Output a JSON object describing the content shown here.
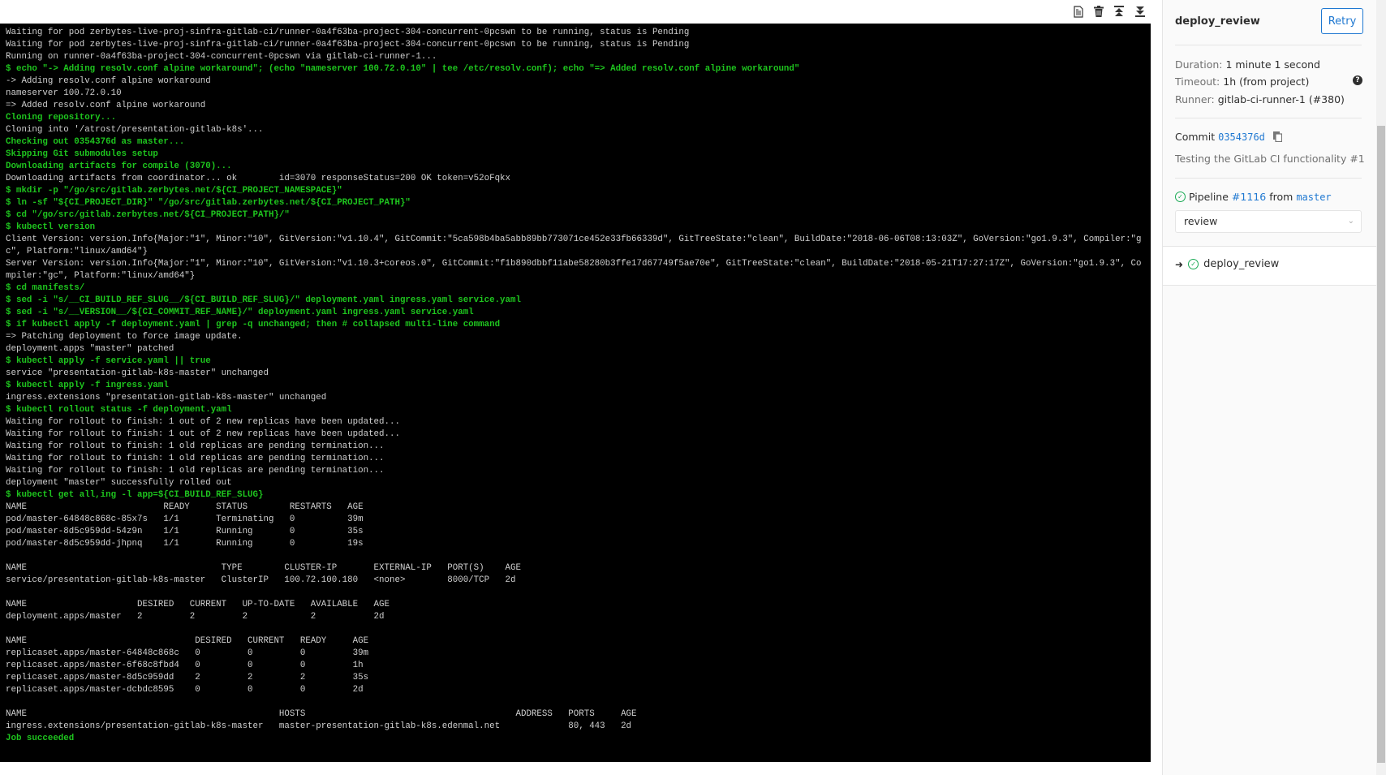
{
  "toolbar": {
    "icons": [
      "raw-log-icon",
      "erase-log-icon",
      "scroll-top-icon",
      "scroll-bottom-icon"
    ]
  },
  "log": [
    {
      "type": "out",
      "text": "Waiting for pod zerbytes-live-proj-sinfra-gitlab-ci/runner-0a4f63ba-project-304-concurrent-0pcswn to be running, status is Pending"
    },
    {
      "type": "out",
      "text": "Waiting for pod zerbytes-live-proj-sinfra-gitlab-ci/runner-0a4f63ba-project-304-concurrent-0pcswn to be running, status is Pending"
    },
    {
      "type": "out",
      "text": "Running on runner-0a4f63ba-project-304-concurrent-0pcswn via gitlab-ci-runner-1..."
    },
    {
      "type": "cmd",
      "text": "$ echo \"-> Adding resolv.conf alpine workaround\"; (echo \"nameserver 100.72.0.10\" | tee /etc/resolv.conf); echo \"=> Added resolv.conf alpine workaround\""
    },
    {
      "type": "out",
      "text": "-> Adding resolv.conf alpine workaround"
    },
    {
      "type": "out",
      "text": "nameserver 100.72.0.10"
    },
    {
      "type": "out",
      "text": "=> Added resolv.conf alpine workaround"
    },
    {
      "type": "section",
      "text": "Cloning repository..."
    },
    {
      "type": "out",
      "text": "Cloning into '/atrost/presentation-gitlab-k8s'..."
    },
    {
      "type": "section",
      "text": "Checking out 0354376d as master..."
    },
    {
      "type": "section",
      "text": "Skipping Git submodules setup"
    },
    {
      "type": "section",
      "text": "Downloading artifacts for compile (3070)..."
    },
    {
      "type": "out",
      "text": "Downloading artifacts from coordinator... ok        id=3070 responseStatus=200 OK token=v52oFqkx"
    },
    {
      "type": "cmd",
      "text": "$ mkdir -p \"/go/src/gitlab.zerbytes.net/${CI_PROJECT_NAMESPACE}\""
    },
    {
      "type": "cmd",
      "text": "$ ln -sf \"${CI_PROJECT_DIR}\" \"/go/src/gitlab.zerbytes.net/${CI_PROJECT_PATH}\""
    },
    {
      "type": "cmd",
      "text": "$ cd \"/go/src/gitlab.zerbytes.net/${CI_PROJECT_PATH}/\""
    },
    {
      "type": "cmd",
      "text": "$ kubectl version"
    },
    {
      "type": "out",
      "text": "Client Version: version.Info{Major:\"1\", Minor:\"10\", GitVersion:\"v1.10.4\", GitCommit:\"5ca598b4ba5abb89bb773071ce452e33fb66339d\", GitTreeState:\"clean\", BuildDate:\"2018-06-06T08:13:03Z\", GoVersion:\"go1.9.3\", Compiler:\"gc\", Platform:\"linux/amd64\"}"
    },
    {
      "type": "out",
      "text": "Server Version: version.Info{Major:\"1\", Minor:\"10\", GitVersion:\"v1.10.3+coreos.0\", GitCommit:\"f1b890dbbf11abe58280b3ffe17d67749f5ae70e\", GitTreeState:\"clean\", BuildDate:\"2018-05-21T17:27:17Z\", GoVersion:\"go1.9.3\", Compiler:\"gc\", Platform:\"linux/amd64\"}"
    },
    {
      "type": "cmd",
      "text": "$ cd manifests/"
    },
    {
      "type": "cmd",
      "text": "$ sed -i \"s/__CI_BUILD_REF_SLUG__/${CI_BUILD_REF_SLUG}/\" deployment.yaml ingress.yaml service.yaml"
    },
    {
      "type": "cmd",
      "text": "$ sed -i \"s/__VERSION__/${CI_COMMIT_REF_NAME}/\" deployment.yaml ingress.yaml service.yaml"
    },
    {
      "type": "cmd",
      "text": "$ if kubectl apply -f deployment.yaml | grep -q unchanged; then # collapsed multi-line command"
    },
    {
      "type": "out",
      "text": "=> Patching deployment to force image update."
    },
    {
      "type": "out",
      "text": "deployment.apps \"master\" patched"
    },
    {
      "type": "cmd",
      "text": "$ kubectl apply -f service.yaml || true"
    },
    {
      "type": "out",
      "text": "service \"presentation-gitlab-k8s-master\" unchanged"
    },
    {
      "type": "cmd",
      "text": "$ kubectl apply -f ingress.yaml"
    },
    {
      "type": "out",
      "text": "ingress.extensions \"presentation-gitlab-k8s-master\" unchanged"
    },
    {
      "type": "cmd",
      "text": "$ kubectl rollout status -f deployment.yaml"
    },
    {
      "type": "out",
      "text": "Waiting for rollout to finish: 1 out of 2 new replicas have been updated..."
    },
    {
      "type": "out",
      "text": "Waiting for rollout to finish: 1 out of 2 new replicas have been updated..."
    },
    {
      "type": "out",
      "text": "Waiting for rollout to finish: 1 old replicas are pending termination..."
    },
    {
      "type": "out",
      "text": "Waiting for rollout to finish: 1 old replicas are pending termination..."
    },
    {
      "type": "out",
      "text": "Waiting for rollout to finish: 1 old replicas are pending termination..."
    },
    {
      "type": "out",
      "text": "deployment \"master\" successfully rolled out"
    },
    {
      "type": "cmd",
      "text": "$ kubectl get all,ing -l app=${CI_BUILD_REF_SLUG}"
    },
    {
      "type": "table",
      "header": [
        "NAME",
        "READY",
        "STATUS",
        "RESTARTS",
        "AGE"
      ],
      "rows": [
        [
          "pod/master-64848c868c-85x7s",
          "1/1",
          "Terminating",
          "0",
          "39m"
        ],
        [
          "pod/master-8d5c959dd-54z9n",
          "1/1",
          "Running",
          "0",
          "35s"
        ],
        [
          "pod/master-8d5c959dd-jhpnq",
          "1/1",
          "Running",
          "0",
          "19s"
        ]
      ]
    },
    {
      "type": "table",
      "header": [
        "NAME",
        "TYPE",
        "CLUSTER-IP",
        "EXTERNAL-IP",
        "PORT(S)",
        "AGE"
      ],
      "rows": [
        [
          "service/presentation-gitlab-k8s-master",
          "ClusterIP",
          "100.72.100.180",
          "<none>",
          "8000/TCP",
          "2d"
        ]
      ]
    },
    {
      "type": "table",
      "header": [
        "NAME",
        "DESIRED",
        "CURRENT",
        "UP-TO-DATE",
        "AVAILABLE",
        "AGE"
      ],
      "rows": [
        [
          "deployment.apps/master",
          "2",
          "2",
          "2",
          "2",
          "2d"
        ]
      ]
    },
    {
      "type": "table",
      "header": [
        "NAME",
        "DESIRED",
        "CURRENT",
        "READY",
        "AGE"
      ],
      "rows": [
        [
          "replicaset.apps/master-64848c868c",
          "0",
          "0",
          "0",
          "39m"
        ],
        [
          "replicaset.apps/master-6f68c8fbd4",
          "0",
          "0",
          "0",
          "1h"
        ],
        [
          "replicaset.apps/master-8d5c959dd",
          "2",
          "2",
          "2",
          "35s"
        ],
        [
          "replicaset.apps/master-dcbdc8595",
          "0",
          "0",
          "0",
          "2d"
        ]
      ]
    },
    {
      "type": "table",
      "header": [
        "NAME",
        "HOSTS",
        "ADDRESS",
        "PORTS",
        "AGE"
      ],
      "rows": [
        [
          "ingress.extensions/presentation-gitlab-k8s-master",
          "master-presentation-gitlab-k8s.edenmal.net",
          "",
          "80, 443",
          "2d"
        ]
      ]
    },
    {
      "type": "ok",
      "text": "Job succeeded"
    }
  ],
  "sidebar": {
    "job_name": "deploy_review",
    "retry_label": "Retry",
    "duration_label": "Duration:",
    "duration_value": "1 minute 1 second",
    "timeout_label": "Timeout:",
    "timeout_value": "1h (from project)",
    "runner_label": "Runner:",
    "runner_value": "gitlab-ci-runner-1 (#380)",
    "commit_label": "Commit",
    "commit_sha": "0354376d",
    "commit_message": "Testing the GitLab CI functionality #1",
    "pipeline_label": "Pipeline",
    "pipeline_id": "#1116",
    "pipeline_from": "from",
    "pipeline_ref": "master",
    "stage_selected": "review",
    "jobs": [
      {
        "name": "deploy_review",
        "status": "success",
        "current": true
      }
    ]
  },
  "colors": {
    "terminal_bg": "#000000",
    "command_green": "#1ec51e",
    "link_blue": "#1f78d1",
    "success_green": "#1aaa55"
  }
}
